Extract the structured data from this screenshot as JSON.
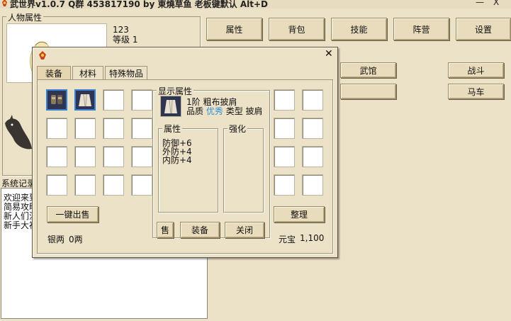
{
  "window": {
    "title": "武世界v1.0.7  Q群 453817190   by 東燒草鱼   老板键默认 Alt+D",
    "minimize_glyph": "—",
    "close_glyph": "X"
  },
  "character_panel": {
    "label": "人物属性",
    "name_value": "123",
    "level_text": "等级 1"
  },
  "top_menu": {
    "buttons": [
      "属性",
      "背包",
      "技能",
      "阵营",
      "设置"
    ],
    "row2": [
      "武馆",
      "战斗",
      "马车"
    ]
  },
  "log_panel": {
    "label": "系统记录",
    "lines": [
      "欢迎来到",
      "简易攻略",
      "新人们注",
      "新手大福"
    ]
  },
  "inventory_dialog": {
    "close_glyph": "✕",
    "tabs": [
      "装备",
      "材料",
      "特殊物品"
    ],
    "active_tab": "装备",
    "sell_all_button": "一键出售",
    "silver_label": "银两",
    "silver_value": "0两",
    "sort_button": "整理",
    "yuanbao_label": "元宝",
    "yuanbao_value": "1,100",
    "detail": {
      "label": "显示属性",
      "item_name": "1阶 粗布披肩",
      "quality_label": "品质",
      "quality_value": "优秀",
      "quality_color": "#2f8fd0",
      "type_label": "类型",
      "type_value": "披肩",
      "attr_label": "属性",
      "attrs": [
        "防御+6",
        "外防+4",
        "内防+4"
      ],
      "enhance_label": "强化",
      "sell_button": "售",
      "equip_button": "装备",
      "close_button": "关闭"
    }
  }
}
